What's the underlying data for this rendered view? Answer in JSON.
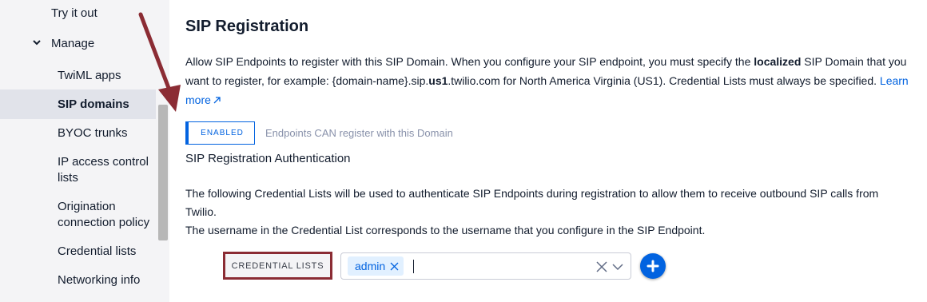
{
  "sidebar": {
    "items": [
      {
        "label": "Try it out"
      },
      {
        "label": "Manage"
      },
      {
        "label": "TwiML apps"
      },
      {
        "label": "SIP domains"
      },
      {
        "label": "BYOC trunks"
      },
      {
        "label": "IP access control lists"
      },
      {
        "label": "Origination connection policy"
      },
      {
        "label": "Credential lists"
      },
      {
        "label": "Networking info"
      }
    ]
  },
  "main": {
    "title": "SIP Registration",
    "description": {
      "part1": "Allow SIP Endpoints to register with this SIP Domain. When you configure your SIP endpoint, you must specify the ",
      "bold1": "localized",
      "part2": " SIP Domain that you want to register, for example: {domain-name}.sip.",
      "bold2": "us1",
      "part3": ".twilio.com for North America Virginia (US1). Credential Lists must always be specified. ",
      "learn_more": "Learn more"
    },
    "toggle": {
      "label": "ENABLED",
      "description": "Endpoints CAN register with this Domain"
    },
    "auth_heading": "SIP Registration Authentication",
    "body_line1": "The following Credential Lists will be used to authenticate SIP Endpoints during registration to allow them to receive outbound SIP calls from Twilio.",
    "body_line2": "The username in the Credential List corresponds to the username that you configure in the SIP Endpoint.",
    "credential_lists": {
      "label": "CREDENTIAL LISTS",
      "selected": [
        "admin"
      ],
      "input_value": ""
    }
  },
  "colors": {
    "accent": "#0263e0",
    "annotation": "#8b2c34",
    "sidebar_bg": "#f4f4f6",
    "active_item_bg": "#e1e3ea"
  },
  "icons": [
    "chevron-down-icon",
    "external-link-icon",
    "close-icon",
    "clear-icon",
    "chevron-down-icon",
    "plus-icon"
  ]
}
